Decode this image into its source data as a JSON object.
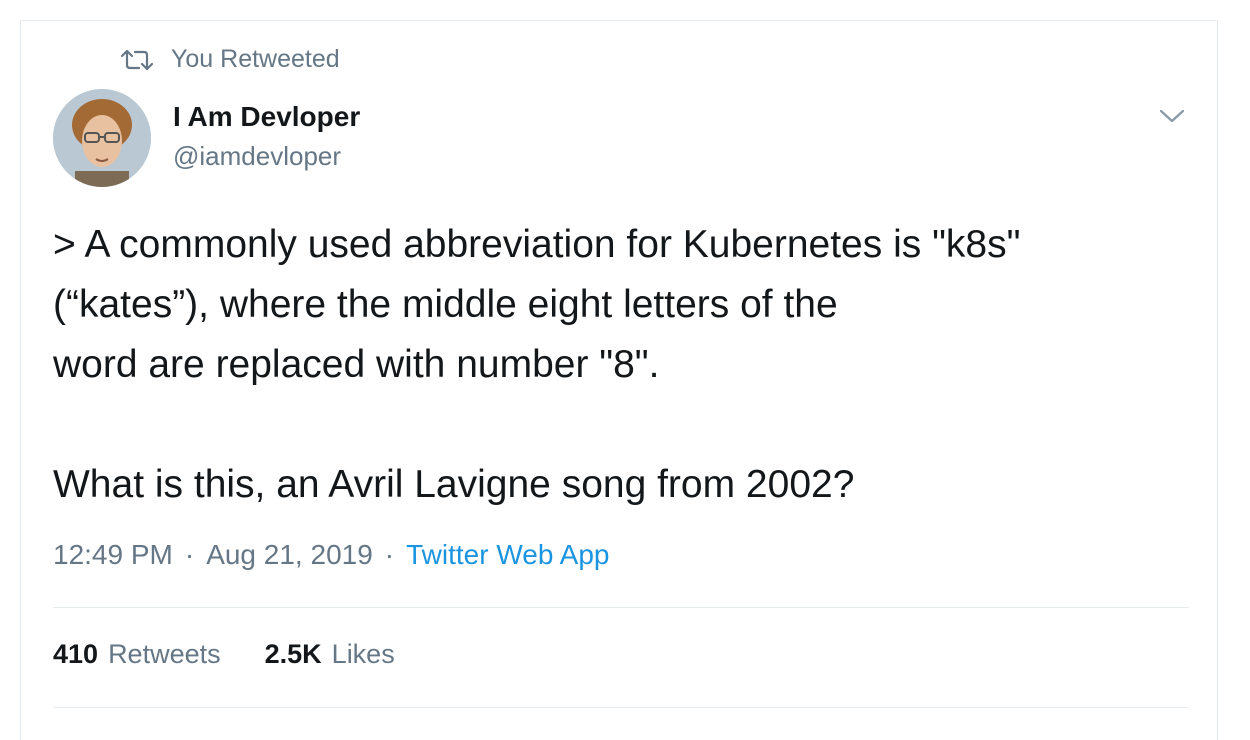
{
  "context": {
    "label": "You Retweeted",
    "icon": "retweet-icon"
  },
  "author": {
    "name": "I Am Devloper",
    "handle": "@iamdevloper",
    "avatar_icon": "avatar-image"
  },
  "tweet": {
    "lines_paragraph1": [
      "> A commonly used abbreviation for Kubernetes is \"k8s\"",
      "(“kates”), where the middle eight letters of the",
      "word are replaced with number \"8\"."
    ],
    "paragraph2": "What is this, an Avril Lavigne song from 2002?"
  },
  "meta": {
    "time": "12:49 PM",
    "date": "Aug 21, 2019",
    "source": "Twitter Web App",
    "separator": "·"
  },
  "stats": {
    "retweets_count": "410",
    "retweets_label": "Retweets",
    "likes_count": "2.5K",
    "likes_label": "Likes"
  },
  "colors": {
    "link": "#1b95e0",
    "muted": "#657786",
    "text": "#14171a",
    "border": "#e6ecf0"
  }
}
